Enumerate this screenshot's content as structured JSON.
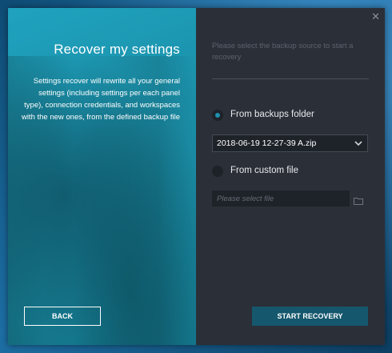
{
  "left_panel": {
    "title": "Recover my settings",
    "description": "Settings recover will rewrite all your general settings (including settings per each panel type), connection credentials, and workspaces with the new ones, from the defined backup file",
    "back_label": "BACK"
  },
  "right_panel": {
    "close_glyph": "✕",
    "hint": "Please select the backup source to start a recovery",
    "option_folder_label": "From backups folder",
    "option_custom_label": "From custom file",
    "selected_option": "From backups folder",
    "backup_select_value": "2018-06-19 12-27-39 A.zip",
    "file_placeholder": "Please select file",
    "start_label": "START RECOVERY"
  },
  "icons": {
    "close": "close-icon",
    "dropdown": "chevron-down-icon",
    "browse": "folder-icon"
  },
  "colors": {
    "accent_teal": "#1fa3bf",
    "panel_dark": "#2b3038",
    "primary_button": "#15576d",
    "radio_on": "#1e8fb0"
  }
}
